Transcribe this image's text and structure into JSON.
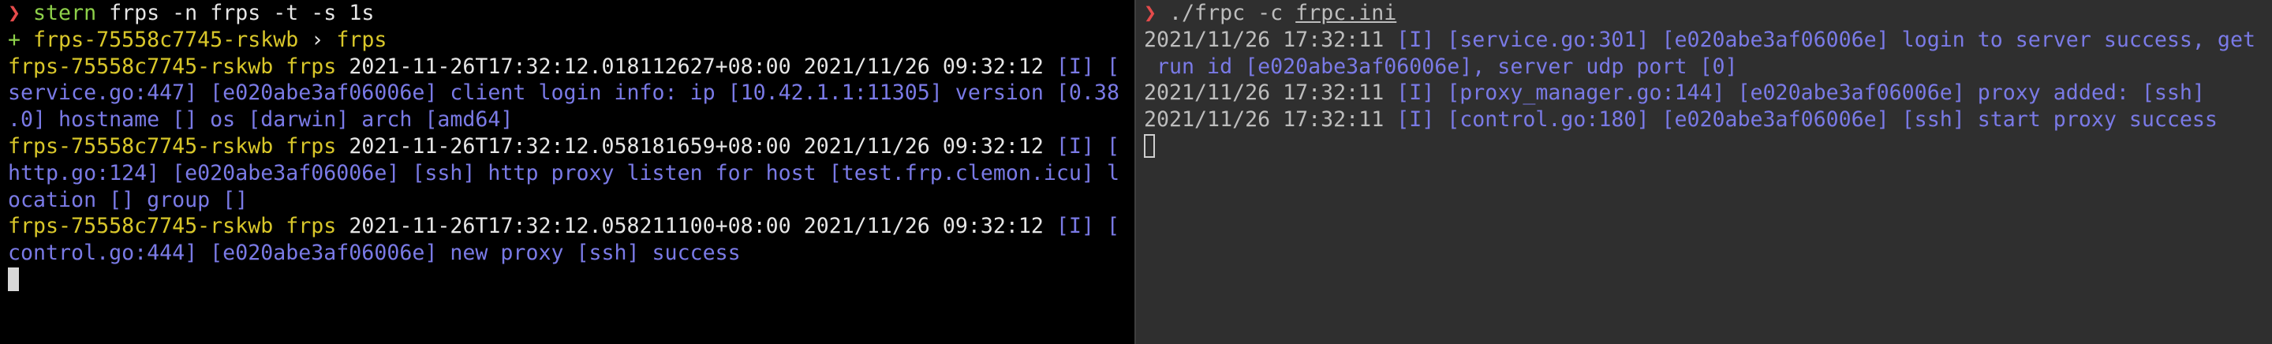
{
  "left_pane": {
    "prompt_symbol": "❯",
    "command": {
      "program": "stern",
      "args": "frps -n frps -t -s 1s"
    },
    "header": {
      "plus": "+",
      "pod": "frps-75558c7745-rskwb",
      "arrow": "›",
      "container": "frps"
    },
    "logs": [
      {
        "pod": "frps-75558c7745-rskwb",
        "container": "frps",
        "timestamp": "2021-11-26T17:32:12.018112627+08:00 2021/11/26 09:32:12",
        "line1_msg": "[I] [",
        "line2": "service.go:447] [e020abe3af06006e] client login info: ip [10.42.1.1:11305] version [0.38",
        "line3": ".0] hostname [] os [darwin] arch [amd64]"
      },
      {
        "pod": "frps-75558c7745-rskwb",
        "container": "frps",
        "timestamp": "2021-11-26T17:32:12.058181659+08:00 2021/11/26 09:32:12",
        "line1_msg": "[I] [",
        "line2": "http.go:124] [e020abe3af06006e] [ssh] http proxy listen for host [test.frp.clemon.icu] l",
        "line3": "ocation [] group []"
      },
      {
        "pod": "frps-75558c7745-rskwb",
        "container": "frps",
        "timestamp": "2021-11-26T17:32:12.058211100+08:00 2021/11/26 09:32:12",
        "line1_msg": "[I] [",
        "line2": "control.go:444] [e020abe3af06006e] new proxy [ssh] success",
        "line3": ""
      }
    ]
  },
  "right_pane": {
    "prompt_symbol": "❯",
    "command": {
      "program": "./frpc",
      "flag": "-c",
      "file": "frpc.ini"
    },
    "logs": [
      {
        "ts": "2021/11/26 17:32:11",
        "msg": "[I] [service.go:301] [e020abe3af06006e] login to server success, get",
        "cont": " run id [e020abe3af06006e], server udp port [0]"
      },
      {
        "ts": "2021/11/26 17:32:11",
        "msg": "[I] [proxy_manager.go:144] [e020abe3af06006e] proxy added: [ssh]",
        "cont": ""
      },
      {
        "ts": "2021/11/26 17:32:11",
        "msg": "[I] [control.go:180] [e020abe3af06006e] [ssh] start proxy success",
        "cont": ""
      }
    ]
  }
}
